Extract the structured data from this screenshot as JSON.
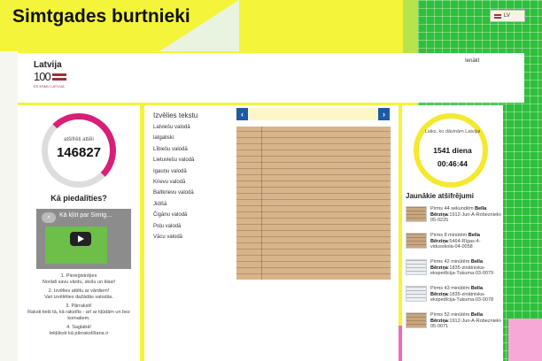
{
  "site_title": "Simtgades burtnieki",
  "language_switch": {
    "code": "LV"
  },
  "header": {
    "logo_line1": "Latvija",
    "logo_line2": "100",
    "logo_sub": "ES ESMU LATVIJA",
    "login": "Ienākt"
  },
  "counter": {
    "label": "atšifrēti attēli",
    "value": "146827"
  },
  "how_to": {
    "title": "Kā piedalīties?",
    "video_title": "Kā kļūt par Simtg...",
    "steps": [
      "1. Piereģistrējies\nNorādi savu vārdu, skolu un klasi!",
      "2. Izvēlies attēlu ar vārdiem!\nVari izvēlēties dažādās valodās.",
      "3. Pārraksti!\nRaksti tieši tā, kā rakstīts - arī ar kļūdām un bez komatiem.",
      "4. Saglabā!\nIekļūksti kā pārrakstīšana ir"
    ]
  },
  "texts": {
    "title": "Izvēlies tekstu",
    "languages": [
      "Latviešu valodā",
      "latgaliski",
      "Lībiešu valodā",
      "Lietuviešu valodā",
      "Igauņu valodā",
      "Krievu valodā",
      "Baltkrievu valodā",
      "Jidišā",
      "Čigānu valodā",
      "Poļu valodā",
      "Vācu valodā"
    ],
    "prev": "‹",
    "next": "›"
  },
  "countdown": {
    "label": "Laiks, ko dāvinām Latvijai",
    "days": "1541 diena",
    "time": "00:46:44"
  },
  "latest": {
    "title": "Jaunākie atšifrējumi",
    "items": [
      {
        "when": "Pirms 44 sekundēm",
        "who": "Bella Bērziņa",
        "ref": ":1912-Jun-A-Robeznieki-05-0225"
      },
      {
        "when": "Pirms 8 minūtēm",
        "who": "Bella Bērziņa",
        "ref": ":5464-Rīgas-4-vidusskola-04-0058"
      },
      {
        "when": "Pirms 42 minūtēm",
        "who": "Bella Bērziņa",
        "ref": ":1835-zinātniska-ekspedīcija-Tukuma-03-0079"
      },
      {
        "when": "Pirms 43 minūtēm",
        "who": "Bella Bērziņa",
        "ref": ":1835-zinātniska-ekspedīcija-Tukuma-03-0078"
      },
      {
        "when": "Pirms 52 minūtēm",
        "who": "Bella Bērziņa",
        "ref": ":1912-Jun-A-Robeznieki-05-0071"
      }
    ]
  }
}
